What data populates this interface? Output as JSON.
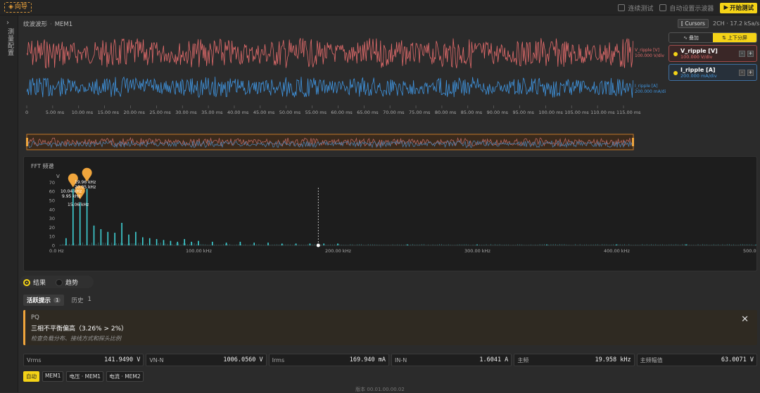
{
  "topbar": {
    "guide_label": "向导",
    "continuous_test_label": "连续测试",
    "auto_waveform_label": "自动设置示波器",
    "start_label": "开始测试"
  },
  "leftrail": {
    "label": "测量配置"
  },
  "waveform": {
    "title": "纹波波形",
    "source": "MEM1",
    "cursors_label": "Cursors",
    "rate": "2CH · 17.2 kSa/s",
    "v_trace_label": "V_ripple [V]",
    "v_trace_div": "100.000 V/div",
    "i_trace_label": "I_ripple [A]",
    "i_trace_div": "200.000 mA/di",
    "time_ticks": [
      "0",
      "5.00 ms",
      "10.00 ms",
      "15.00 ms",
      "20.00 ms",
      "25.00 ms",
      "30.00 ms",
      "35.00 ms",
      "40.00 ms",
      "45.00 ms",
      "50.00 ms",
      "55.00 ms",
      "60.00 ms",
      "65.00 ms",
      "70.00 ms",
      "75.00 ms",
      "80.00 ms",
      "85.00 ms",
      "90.00 ms",
      "95.00 ms",
      "100.00 ms",
      "105.00 ms",
      "110.00 ms",
      "115.00 ms"
    ]
  },
  "channels": {
    "mode_overlay": "叠加",
    "mode_split": "上下分屏",
    "v": {
      "name": "V_ripple [V]",
      "div": "100.000 V/div"
    },
    "i": {
      "name": "I_ripple [A]",
      "div": "200.000 mA/div"
    }
  },
  "fft": {
    "title": "FFT 频谱",
    "ylabel": "V",
    "markers": [
      "19.96 kHz",
      "20.05 kHz",
      "10.04 kHz",
      "9.95 kHz",
      "15.06 kHz"
    ]
  },
  "chart_data": {
    "type": "bar",
    "title": "FFT 频谱",
    "ylabel": "V",
    "xlabel": "",
    "xlim": [
      0,
      500
    ],
    "ylim": [
      0,
      75
    ],
    "x_unit": "kHz",
    "xticks": [
      "0.0 Hz",
      "100.00 kHz",
      "200.00 kHz",
      "300.00 kHz",
      "400.00 kHz",
      "500.00 kHz"
    ],
    "yticks": [
      "0",
      "10",
      "20",
      "30",
      "40",
      "50",
      "60",
      "70"
    ],
    "peaks": [
      {
        "x": 5,
        "y": 8
      },
      {
        "x": 10,
        "y": 63
      },
      {
        "x": 15,
        "y": 48
      },
      {
        "x": 20,
        "y": 63
      },
      {
        "x": 25,
        "y": 22
      },
      {
        "x": 30,
        "y": 18
      },
      {
        "x": 35,
        "y": 15
      },
      {
        "x": 40,
        "y": 14
      },
      {
        "x": 45,
        "y": 25
      },
      {
        "x": 50,
        "y": 12
      },
      {
        "x": 55,
        "y": 15
      },
      {
        "x": 60,
        "y": 9
      },
      {
        "x": 65,
        "y": 8
      },
      {
        "x": 70,
        "y": 7
      },
      {
        "x": 75,
        "y": 6
      },
      {
        "x": 80,
        "y": 5
      },
      {
        "x": 85,
        "y": 4
      },
      {
        "x": 90,
        "y": 7
      },
      {
        "x": 95,
        "y": 4
      },
      {
        "x": 100,
        "y": 5
      },
      {
        "x": 110,
        "y": 4
      },
      {
        "x": 120,
        "y": 3
      },
      {
        "x": 130,
        "y": 4
      },
      {
        "x": 140,
        "y": 3
      },
      {
        "x": 150,
        "y": 3
      },
      {
        "x": 160,
        "y": 2
      },
      {
        "x": 170,
        "y": 2
      },
      {
        "x": 180,
        "y": 2
      },
      {
        "x": 190,
        "y": 2
      },
      {
        "x": 200,
        "y": 2
      },
      {
        "x": 250,
        "y": 1
      },
      {
        "x": 300,
        "y": 1
      },
      {
        "x": 350,
        "y": 1
      },
      {
        "x": 400,
        "y": 1
      },
      {
        "x": 450,
        "y": 1
      },
      {
        "x": 500,
        "y": 0.5
      }
    ],
    "cursor_x": 186
  },
  "results": {
    "tab_result": "结果",
    "tab_trend": "趋势",
    "tab_active": "活跃提示",
    "active_count": "1",
    "tab_history": "历史",
    "history_count": "1"
  },
  "alert": {
    "title": "PQ",
    "message": "三相不平衡偏高（3.26% > 2%）",
    "hint": "检查负载分布、接线方式和探头比例"
  },
  "metrics": [
    {
      "k": "Vrms",
      "v": "141.9490 V"
    },
    {
      "k": "VN-N",
      "v": "1006.0560 V"
    },
    {
      "k": "Irms",
      "v": "169.940 mA"
    },
    {
      "k": "IN-N",
      "v": "1.6041 A"
    },
    {
      "k": "主频",
      "v": "19.958 kHz"
    },
    {
      "k": "主频幅值",
      "v": "63.0071 V"
    }
  ],
  "chips": [
    "自动",
    "MEM1",
    "电压 · MEM1",
    "电流 · MEM2"
  ],
  "footer": "版本 00.01.00.00.02",
  "colors": {
    "accent": "#f4d317",
    "voltage": "#e26b6b",
    "current": "#3f93dd",
    "fft": "#3fd2d6",
    "warning": "#f0a53c"
  }
}
